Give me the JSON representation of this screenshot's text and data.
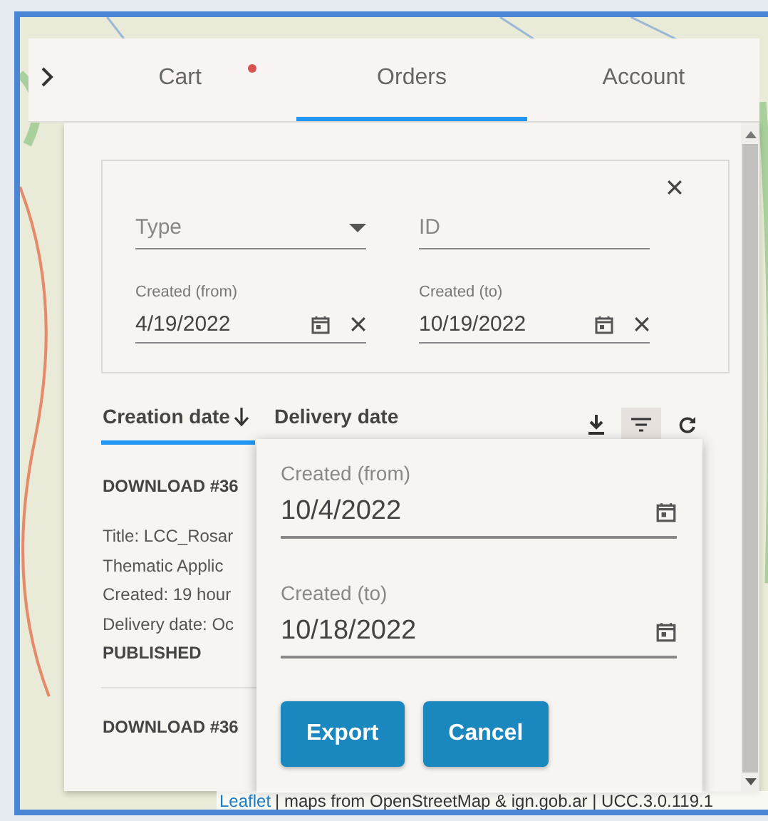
{
  "tabs": [
    {
      "label": "Cart",
      "selected": false,
      "badge": true
    },
    {
      "label": "Orders",
      "selected": true,
      "badge": false
    },
    {
      "label": "Account",
      "selected": false,
      "badge": false
    }
  ],
  "filters": {
    "type": {
      "placeholder": "Type"
    },
    "id": {
      "placeholder": "ID"
    },
    "created_from": {
      "label": "Created (from)",
      "value": "4/19/2022"
    },
    "created_to": {
      "label": "Created (to)",
      "value": "10/19/2022"
    }
  },
  "sort": [
    {
      "label": "Creation date",
      "selected": true
    },
    {
      "label": "Delivery date",
      "selected": false
    }
  ],
  "tools": [
    {
      "kind": "download",
      "active": false
    },
    {
      "kind": "filter",
      "active": true
    },
    {
      "kind": "refresh",
      "active": false
    }
  ],
  "orders": [
    {
      "title": "DOWNLOAD #36",
      "lines": [
        "Title: LCC_Rosar",
        "Thematic Applic",
        "Created: 19 hour",
        "Delivery date: Oc"
      ],
      "status": "PUBLISHED"
    },
    {
      "title": "DOWNLOAD #36"
    }
  ],
  "export_popup": {
    "fields": [
      {
        "label": "Created (from)",
        "value": "10/4/2022"
      },
      {
        "label": "Created (to)",
        "value": "10/18/2022"
      }
    ],
    "buttons": [
      "Export",
      "Cancel"
    ]
  },
  "attribution": {
    "link": "Leaflet",
    "text": "| maps from OpenStreetMap & ign.gob.ar | UCC.3.0.119.1"
  }
}
